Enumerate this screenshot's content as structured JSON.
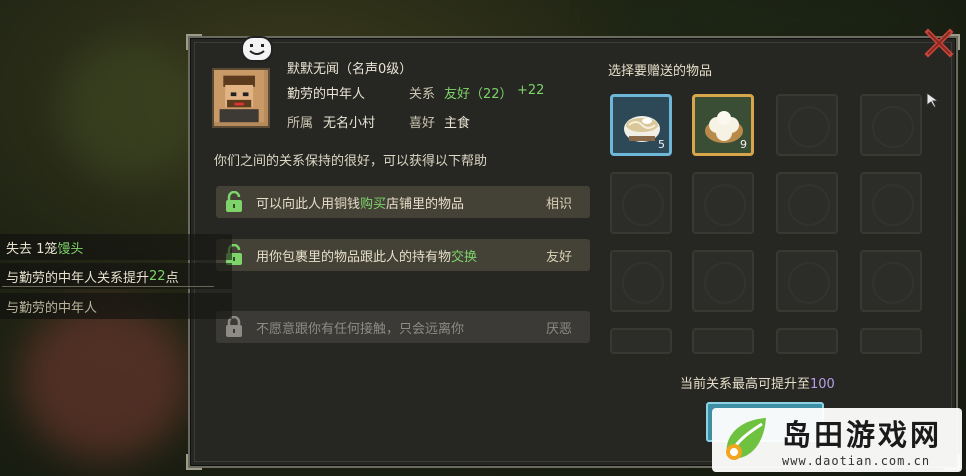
{
  "npc": {
    "name": "默默无闻（名声0级）",
    "title": "勤劳的中年人",
    "relation_label": "关系",
    "relation_value": "友好（22）",
    "relation_delta": "+22",
    "affiliation_label": "所属",
    "affiliation_value": "无名小村",
    "preference_label": "喜好",
    "preference_value": "主食"
  },
  "help_text": "你们之间的关系保持的很好，可以获得以下帮助",
  "benefits": [
    {
      "pre": "可以向此人用铜钱",
      "hl": "购买",
      "post": "店铺里的物品",
      "level": "相识",
      "locked": false
    },
    {
      "pre": "用你包裹里的物品跟此人的持有物",
      "hl": "交换",
      "post": "",
      "level": "友好",
      "locked": false
    },
    {
      "pre": "不愿意跟你有任何接触，只会远离你",
      "hl": "",
      "post": "",
      "level": "厌恶",
      "locked": true
    }
  ],
  "log": {
    "line1_pre": "失去 1笼",
    "line1_hl": "馒头",
    "line2_pre": "与勤劳的中年人关系提升",
    "line2_num": "22",
    "line2_post": "点",
    "line3": "与勤劳的中年人"
  },
  "gift": {
    "title": "选择要赠送的物品",
    "items": [
      {
        "icon": "noodle-bowl-icon",
        "count": "5"
      },
      {
        "icon": "steamed-bun-icon",
        "count": "9"
      }
    ]
  },
  "cap": {
    "pre": "当前关系最高可提升至",
    "value": "100"
  },
  "watermark": {
    "title": "岛田游戏网",
    "url": "www.daotian.com.cn"
  },
  "colors": {
    "highlight_green": "#7ed36a",
    "cap_purple": "#b79ee8",
    "slot_blue": "#6fb7d9",
    "slot_gold": "#d8a64a"
  }
}
